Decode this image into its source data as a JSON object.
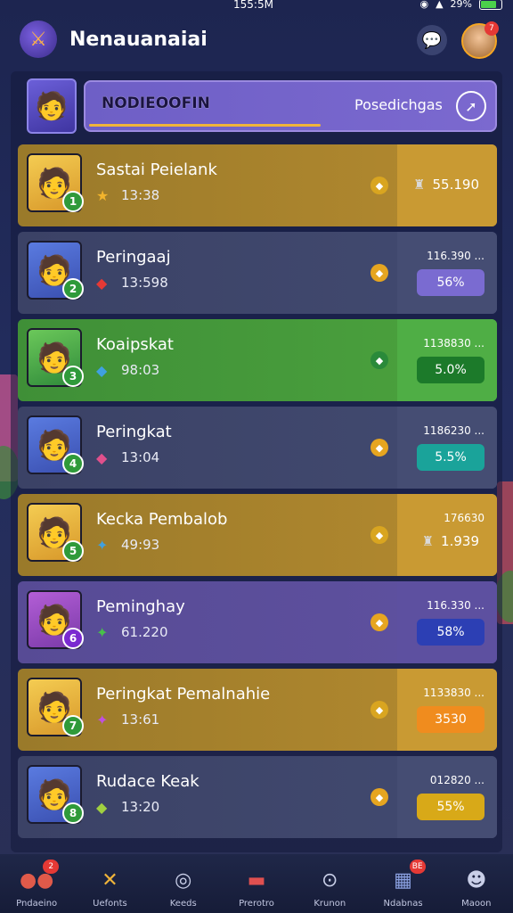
{
  "status_bar": {
    "time": "155:5M",
    "battery": "29%"
  },
  "header": {
    "title": "Nenauanaiai",
    "logo_icon": "sword-shield-icon",
    "notification_count": "7"
  },
  "banner": {
    "name": "NODIEOOFIN",
    "action_label": "Posedichgas",
    "action_icon": "compass-icon",
    "progress": 0.56
  },
  "rows": [
    {
      "name": "Sastai Peielank",
      "stat": "13:38",
      "stat_icon": "★",
      "mid_icon": "◆",
      "score_top": "",
      "score_value": "55.190",
      "score_icon": "♜",
      "rank": "1",
      "theme": "gold",
      "pill_color": ""
    },
    {
      "name": "Peringaaj",
      "stat": "13:598",
      "stat_icon": "◆",
      "mid_icon": "◆",
      "score_top": "116.390 ...",
      "score_value": "56%",
      "score_icon": "",
      "rank": "2",
      "theme": "slate",
      "pill_color": "#7a6bd1"
    },
    {
      "name": "Koaipskat",
      "stat": "98:03",
      "stat_icon": "◆",
      "mid_icon": "◆",
      "score_top": "1138830 ...",
      "score_value": "5.0%",
      "score_icon": "",
      "rank": "3",
      "theme": "green",
      "pill_color": "#1c7a2a"
    },
    {
      "name": "Peringkat",
      "stat": "13:04",
      "stat_icon": "◆",
      "mid_icon": "◆",
      "score_top": "1186230 ...",
      "score_value": "5.5%",
      "score_icon": "",
      "rank": "4",
      "theme": "slate",
      "pill_color": "#1aa39a"
    },
    {
      "name": "Kecka Pembalob",
      "stat": "49:93",
      "stat_icon": "✦",
      "mid_icon": "◆",
      "score_top": "176630",
      "score_value": "1.939",
      "score_icon": "♜",
      "rank": "5",
      "theme": "gold",
      "pill_color": ""
    },
    {
      "name": "Peminghay",
      "stat": "61.220",
      "stat_icon": "✦",
      "mid_icon": "◆",
      "score_top": "116.330 ...",
      "score_value": "58%",
      "score_icon": "",
      "rank": "6",
      "theme": "purple",
      "pill_color": "#2c3fb4"
    },
    {
      "name": "Peringkat Pemalnahie",
      "stat": "13:61",
      "stat_icon": "✦",
      "mid_icon": "◆",
      "score_top": "1133830 ...",
      "score_value": "3530",
      "score_icon": "",
      "rank": "7",
      "theme": "gold",
      "pill_color": "#f08c1e"
    },
    {
      "name": "Rudace Keak",
      "stat": "13:20",
      "stat_icon": "◆",
      "mid_icon": "◆",
      "score_top": "012820 ...",
      "score_value": "55%",
      "score_icon": "",
      "rank": "8",
      "theme": "slate",
      "pill_color": "#d8a918"
    }
  ],
  "nav": [
    {
      "label": "Pndaeino",
      "icon": "group-icon",
      "glyph": "●●",
      "badge": "2"
    },
    {
      "label": "Uefonts",
      "icon": "map-icon",
      "glyph": "✕",
      "badge": ""
    },
    {
      "label": "Keeds",
      "icon": "home-icon",
      "glyph": "◎",
      "badge": ""
    },
    {
      "label": "Prerotro",
      "icon": "shop-icon",
      "glyph": "▬",
      "badge": ""
    },
    {
      "label": "Krunon",
      "icon": "search-icon",
      "glyph": "⊙",
      "badge": ""
    },
    {
      "label": "Ndabnas",
      "icon": "calendar-icon",
      "glyph": "▦",
      "badge": "BE"
    },
    {
      "label": "Maoon",
      "icon": "profile-icon",
      "glyph": "☻",
      "badge": ""
    }
  ]
}
